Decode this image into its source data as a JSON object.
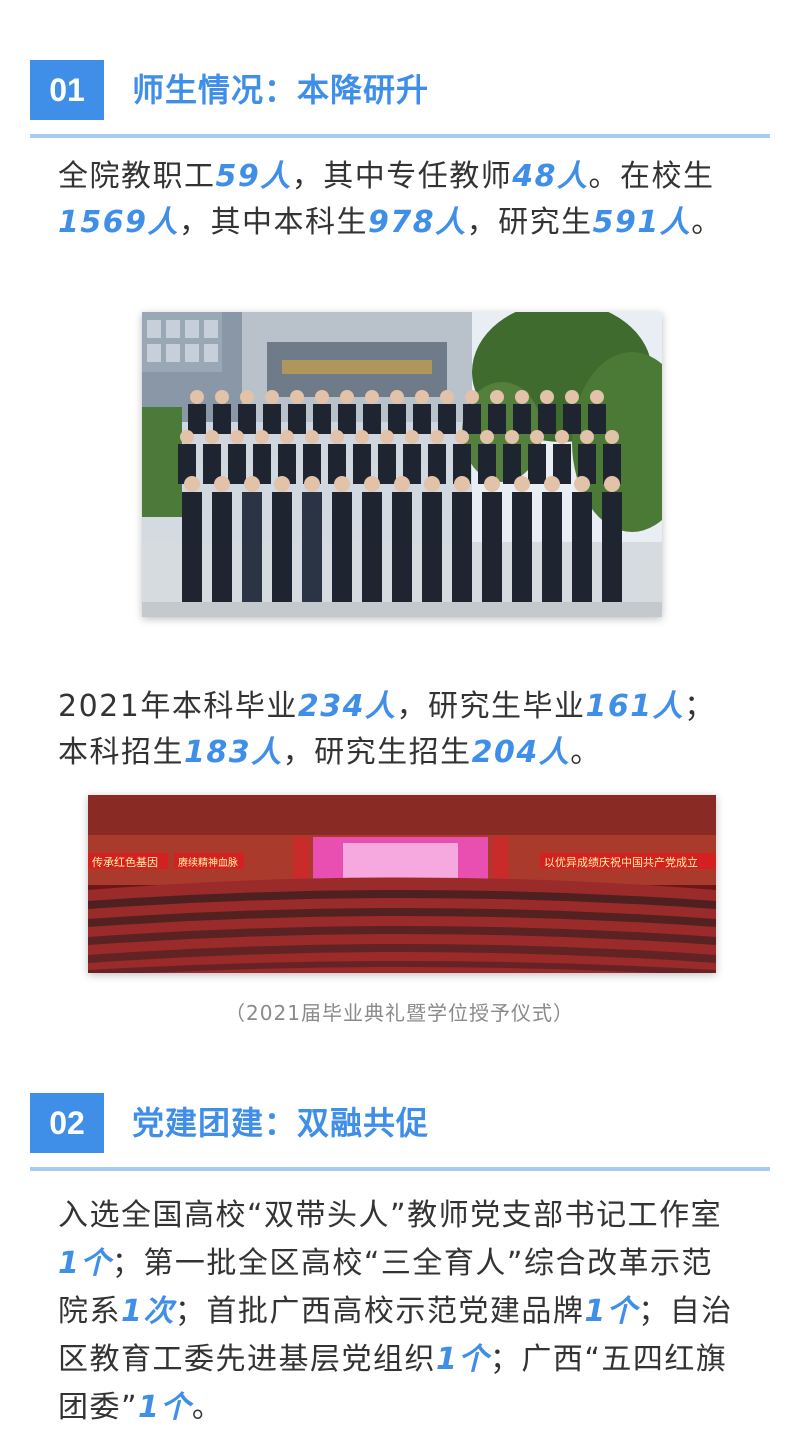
{
  "section1": {
    "number": "01",
    "title": "师生情况：本降研升",
    "para1": {
      "t1": "全院教职工",
      "h1": "59人",
      "t2": "，其中专任教师",
      "h2": "48人",
      "t3": "。在校生",
      "h3": "1569人",
      "t4": "，其中本科生",
      "h4": "978人",
      "t5": "，研究生",
      "h5": "591人",
      "t6": "。"
    },
    "para2": {
      "t1": "2021年本科毕业",
      "h1": "234人",
      "t2": "，研究生毕业",
      "h2": "161人",
      "t3": "；本科招生",
      "h3": "183人",
      "t4": "，研究生招生",
      "h4": "204人",
      "t5": "。"
    },
    "caption": "（2021届毕业典礼暨学位授予仪式）",
    "banner_left": "传承红色基因",
    "banner_left2": "赓续精神血脉",
    "banner_right": "以优异成绩庆祝中国共产党成立"
  },
  "section2": {
    "number": "02",
    "title": "党建团建：双融共促",
    "para": {
      "t1": "入选全国高校“双带头人”教师党支部书记工作室",
      "h1": "1个",
      "t2": "；第一批全区高校“三全育人”综合改革示范院系",
      "h2": "1次",
      "t3": "；首批广西高校示范党建品牌",
      "h3": "1个",
      "t4": "；自治区教育工委先进基层党组织",
      "h4": "1个",
      "t5": "；广西“五四红旗团委”",
      "h5": "1个",
      "t6": "。"
    }
  },
  "colors": {
    "accent": "#3f8ee8",
    "rule": "#a9cbf2",
    "text": "#333333",
    "caption": "#8a8a8a"
  }
}
